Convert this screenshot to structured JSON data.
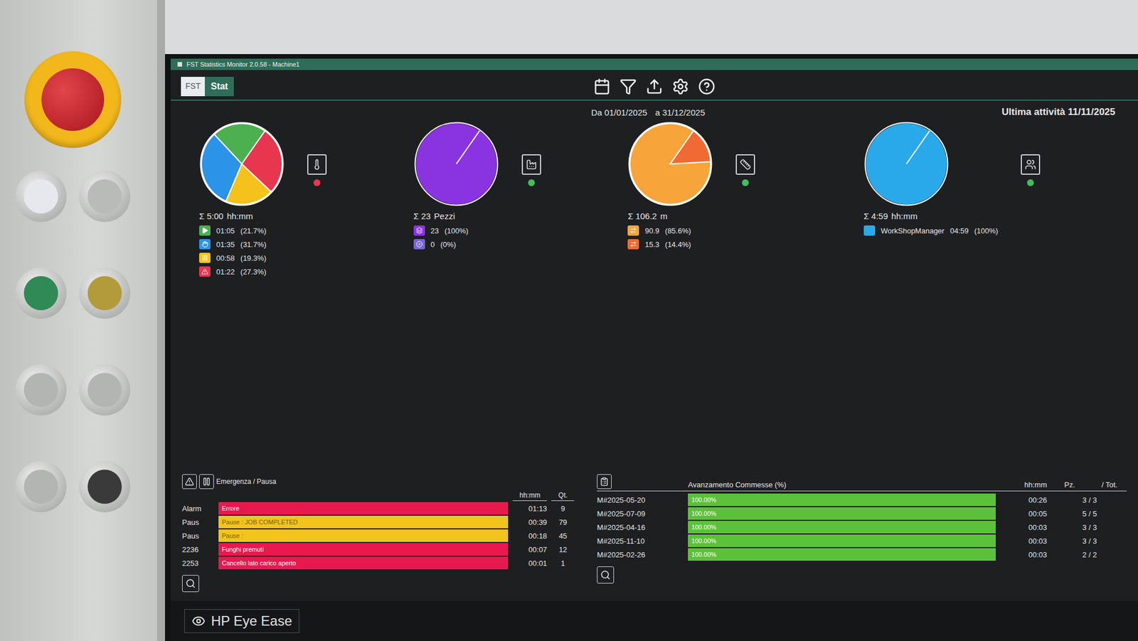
{
  "window": {
    "title": "FST Statistics Monitor 2.0.58 - Machine1"
  },
  "app": {
    "logo": "FST",
    "tab": "Stat"
  },
  "period": {
    "from": "Da 01/01/2025",
    "to": "a 31/12/2025"
  },
  "last_activity": "Ultima attività 11/11/2025",
  "charts": [
    {
      "total": "Σ 5:00",
      "unit": "hh:mm",
      "indicator": {
        "kind": "thermometer",
        "color": "#e8364f"
      },
      "legend": [
        {
          "kind": "run",
          "label": "",
          "value": "01:05",
          "percent": "(21.7%)",
          "color": "#4caf50",
          "amount": 65
        },
        {
          "kind": "manual",
          "label": "",
          "value": "01:35",
          "percent": "(31.7%)",
          "color": "#2b93e8",
          "amount": 95
        },
        {
          "kind": "pause",
          "label": "",
          "value": "00:58",
          "percent": "(19.3%)",
          "color": "#f5c21b",
          "amount": 58
        },
        {
          "kind": "alarm",
          "label": "",
          "value": "01:22",
          "percent": "(27.3%)",
          "color": "#e8364f",
          "amount": 82
        }
      ]
    },
    {
      "total": "Σ 23",
      "unit": "Pezzi",
      "indicator": {
        "kind": "factory",
        "color": "#3fbf5a"
      },
      "legend": [
        {
          "kind": "good",
          "label": "",
          "value": "23",
          "percent": "(100%)",
          "color": "#8a33e0",
          "amount": 23
        },
        {
          "kind": "scrap",
          "label": "",
          "value": "0",
          "percent": "(0%)",
          "color": "#7a63d8",
          "amount": 0
        }
      ]
    },
    {
      "total": "Σ 106.2",
      "unit": "m",
      "indicator": {
        "kind": "meter",
        "color": "#3fbf5a"
      },
      "legend": [
        {
          "kind": "work",
          "label": "",
          "value": "90.9",
          "percent": "(85.6%)",
          "color": "#f7a53a",
          "amount": 90.9
        },
        {
          "kind": "idle",
          "label": "",
          "value": "15.3",
          "percent": "(14.4%)",
          "color": "#f26a33",
          "amount": 15.3
        }
      ]
    },
    {
      "total": "Σ 4:59",
      "unit": "hh:mm",
      "indicator": {
        "kind": "user",
        "color": "#3fbf5a"
      },
      "legend": [
        {
          "kind": "user",
          "label": "WorkShopManager",
          "value": "04:59",
          "percent": "(100%)",
          "color": "#2aa9ea",
          "amount": 299
        }
      ]
    }
  ],
  "alarms": {
    "title": "Emergenza / Pausa",
    "columns": [
      "hh:mm",
      "Qt."
    ],
    "rows": [
      {
        "code": "Alarm",
        "text": "Errore",
        "time": "01:13",
        "qty": "9",
        "level": 1,
        "color": "#e8194f"
      },
      {
        "code": "Paus",
        "text": "Pause : JOB COMPLETED",
        "time": "00:39",
        "qty": "79",
        "level": 1,
        "color": "#f2c41c"
      },
      {
        "code": "Paus",
        "text": "Pause :",
        "time": "00:18",
        "qty": "45",
        "level": 1,
        "color": "#f2c41c"
      },
      {
        "code": "2236",
        "text": "Funghi premuti",
        "time": "00:07",
        "qty": "12",
        "level": 1,
        "color": "#e8194f"
      },
      {
        "code": "2253",
        "text": "Cancello lato carico aperto",
        "time": "00:01",
        "qty": "1",
        "level": 1,
        "color": "#e8194f"
      }
    ]
  },
  "jobs": {
    "title": "Avanzamento Commesse (%)",
    "columns": [
      "hh:mm",
      "Pz.",
      "/ Tot."
    ],
    "rows": [
      {
        "name": "M#2025-05-20",
        "progress": "100.00%",
        "level": 1,
        "time": "00:26",
        "pieces": "3 / 3"
      },
      {
        "name": "M#2025-07-09",
        "progress": "100.00%",
        "level": 1,
        "time": "00:05",
        "pieces": "5 / 5"
      },
      {
        "name": "M#2025-04-16",
        "progress": "100.00%",
        "level": 1,
        "time": "00:03",
        "pieces": "3 / 3"
      },
      {
        "name": "M#2025-11-10",
        "progress": "100.00%",
        "level": 1,
        "time": "00:03",
        "pieces": "3 / 3"
      },
      {
        "name": "M#2025-02-26",
        "progress": "100.00%",
        "level": 1,
        "time": "00:03",
        "pieces": "2 / 2"
      }
    ]
  },
  "monitor": {
    "label": "HP Eye Ease"
  }
}
